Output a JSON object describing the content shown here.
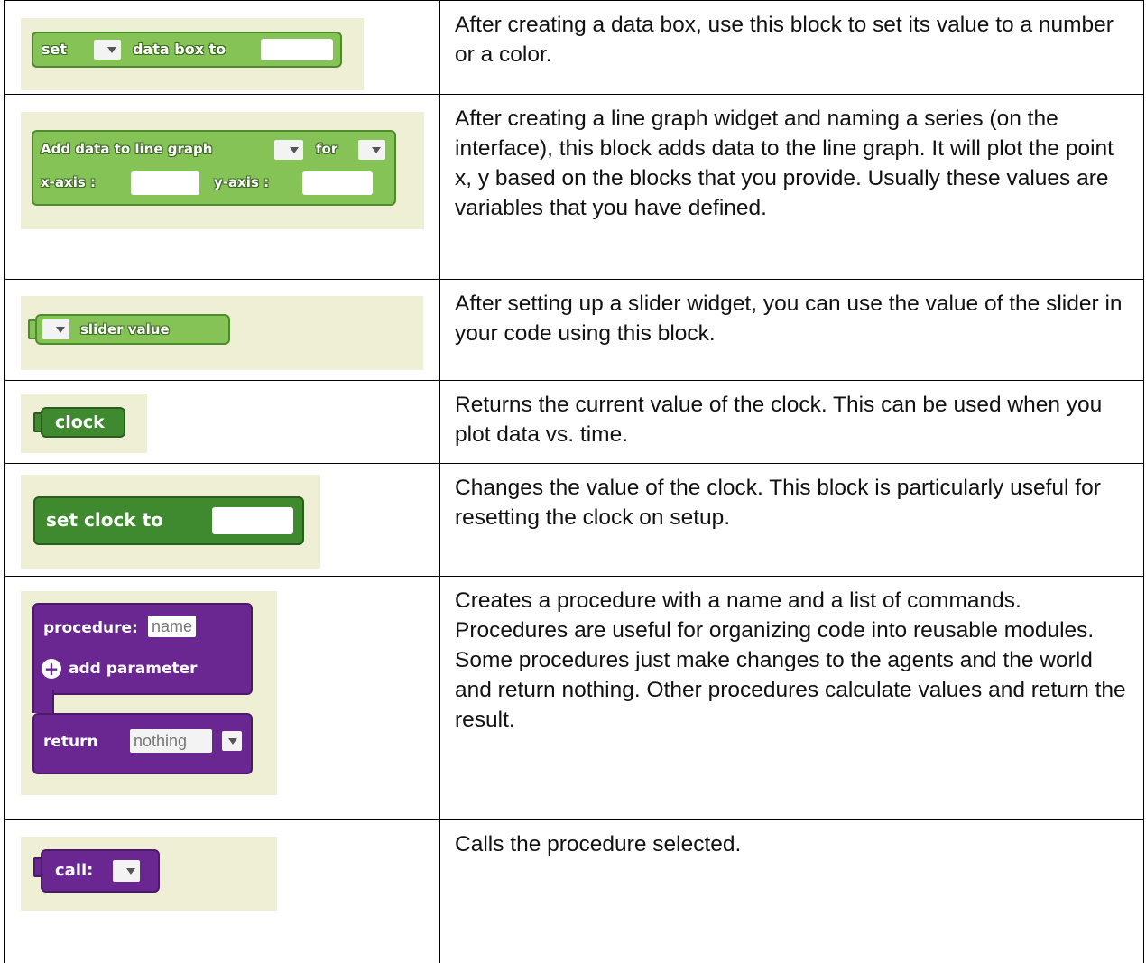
{
  "rows": [
    {
      "block": {
        "set": "set",
        "label": "data box to"
      },
      "description": "After creating a data box, use this block to set its value to a number or a color."
    },
    {
      "block": {
        "title": "Add data to line graph",
        "for": "for",
        "x_axis": "x-axis :",
        "y_axis": "y-axis :"
      },
      "description": "After creating a line graph widget and naming a series (on the interface), this block adds data to the line graph. It will plot the point x, y based on the blocks that you provide. Usually these values are variables that you have defined."
    },
    {
      "block": {
        "label": "slider value"
      },
      "description": "After setting up a slider widget, you can use the value of the slider in your code using this block."
    },
    {
      "block": {
        "label": "clock"
      },
      "description": "Returns the current value of the clock. This can be used when you plot data vs. time."
    },
    {
      "block": {
        "label": "set clock to"
      },
      "description": "Changes the value of the clock.  This block is particularly useful for resetting the clock on setup."
    },
    {
      "block": {
        "procedure": "procedure:",
        "name": "name",
        "add_parameter": "add parameter",
        "return": "return",
        "nothing": "nothing",
        "plus": "+"
      },
      "description": "Creates a procedure with a name and a list of commands. Procedures are useful for organizing code into reusable modules. Some procedures just make changes to the agents and the world and return nothing. Other procedures calculate values and return the result."
    },
    {
      "block": {
        "label": "call:"
      },
      "description": "Calls the procedure selected."
    }
  ],
  "colors": {
    "panel": "#efefd5",
    "green_block": "#86c356",
    "dark_green_block": "#3f8a2f",
    "purple_block": "#6a2791"
  }
}
